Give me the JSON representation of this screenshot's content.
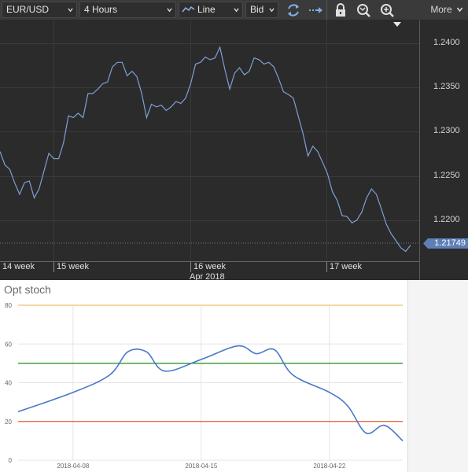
{
  "toolbar": {
    "instrument": "EUR/USD",
    "period": "4 Hours",
    "chart_type": "Line",
    "side": "Bid",
    "more_label": "More",
    "icons": [
      "refresh-icon",
      "autoscroll-icon",
      "lock-icon",
      "crosshair-icon",
      "zoom-in-icon"
    ]
  },
  "price_chart": {
    "y_ticks": [
      "1.2400",
      "1.2350",
      "1.2300",
      "1.2250",
      "1.2200"
    ],
    "current_price": "1.21749",
    "weeks": [
      "14 week",
      "15 week",
      "16 week",
      "17 week"
    ],
    "month": "Apr 2018",
    "line_color": "#7f9fd6",
    "series": [
      1.228,
      1.2265,
      1.226,
      1.2245,
      1.2232,
      1.2245,
      1.2247,
      1.2228,
      1.2238,
      1.2258,
      1.2278,
      1.2272,
      1.2272,
      1.229,
      1.232,
      1.2318,
      1.2323,
      1.2318,
      1.2345,
      1.2345,
      1.235,
      1.2356,
      1.2358,
      1.2375,
      1.238,
      1.238,
      1.2365,
      1.237,
      1.2364,
      1.2345,
      1.2318,
      1.2333,
      1.233,
      1.2332,
      1.2326,
      1.233,
      1.2336,
      1.2334,
      1.234,
      1.2356,
      1.2378,
      1.238,
      1.2386,
      1.2383,
      1.2385,
      1.2397,
      1.2372,
      1.235,
      1.2368,
      1.2374,
      1.2366,
      1.237,
      1.2385,
      1.2383,
      1.2378,
      1.238,
      1.2375,
      1.2362,
      1.2347,
      1.2344,
      1.234,
      1.232,
      1.23,
      1.2275,
      1.2286,
      1.228,
      1.2268,
      1.2255,
      1.2235,
      1.2225,
      1.2208,
      1.2207,
      1.22,
      1.2203,
      1.2212,
      1.2228,
      1.2238,
      1.2232,
      1.2216,
      1.2199,
      1.2188,
      1.218,
      1.2172,
      1.2168,
      1.2175
    ]
  },
  "stoch_chart": {
    "title": "Opt stoch",
    "y_ticks": [
      "0",
      "20",
      "40",
      "60",
      "80"
    ],
    "x_ticks": [
      "2018-04-08",
      "2018-04-15",
      "2018-04-22"
    ],
    "line_color": "#4a78c8",
    "levels": [
      {
        "value": 80,
        "color": "#f0c070"
      },
      {
        "value": 50,
        "color": "#1a8a1a"
      },
      {
        "value": 20,
        "color": "#e06030"
      }
    ]
  },
  "chart_data": [
    {
      "type": "line",
      "title": "",
      "series": [
        {
          "values": [
            1.228,
            1.2265,
            1.226,
            1.2245,
            1.2232,
            1.2245,
            1.2247,
            1.2228,
            1.2238,
            1.2258,
            1.2278,
            1.2272,
            1.2272,
            1.229,
            1.232,
            1.2318,
            1.2323,
            1.2318,
            1.2345,
            1.2345,
            1.235,
            1.2356,
            1.2358,
            1.2375,
            1.238,
            1.238,
            1.2365,
            1.237,
            1.2364,
            1.2345,
            1.2318,
            1.2333,
            1.233,
            1.2332,
            1.2326,
            1.233,
            1.2336,
            1.2334,
            1.234,
            1.2356,
            1.2378,
            1.238,
            1.2386,
            1.2383,
            1.2385,
            1.2397,
            1.2372,
            1.235,
            1.2368,
            1.2374,
            1.2366,
            1.237,
            1.2385,
            1.2383,
            1.2378,
            1.238,
            1.2375,
            1.2362,
            1.2347,
            1.2344,
            1.234,
            1.232,
            1.23,
            1.2275,
            1.2286,
            1.228,
            1.2268,
            1.2255,
            1.2235,
            1.2225,
            1.2208,
            1.2207,
            1.22,
            1.2203,
            1.2212,
            1.2228,
            1.2238,
            1.2232,
            1.2216,
            1.2199,
            1.2188,
            1.218,
            1.2172,
            1.2168,
            1.2175
          ]
        }
      ],
      "ylim": [
        1.2157,
        1.2427
      ],
      "grid": true
    },
    {
      "type": "line",
      "title": "Opt stoch",
      "x": [
        "2018-04-05",
        "2018-04-08",
        "2018-04-10",
        "2018-04-11",
        "2018-04-12",
        "2018-04-13",
        "2018-04-15",
        "2018-04-17",
        "2018-04-18",
        "2018-04-19",
        "2018-04-20",
        "2018-04-22",
        "2018-04-23",
        "2018-04-24",
        "2018-04-25",
        "2018-04-26"
      ],
      "series": [
        {
          "values": [
            25,
            35,
            44,
            56,
            56,
            46,
            52,
            59,
            55,
            57,
            44,
            35,
            28,
            14,
            18,
            10
          ]
        }
      ],
      "ylim": [
        0,
        80
      ],
      "reference_lines": [
        80,
        50,
        20
      ],
      "grid": true
    }
  ]
}
